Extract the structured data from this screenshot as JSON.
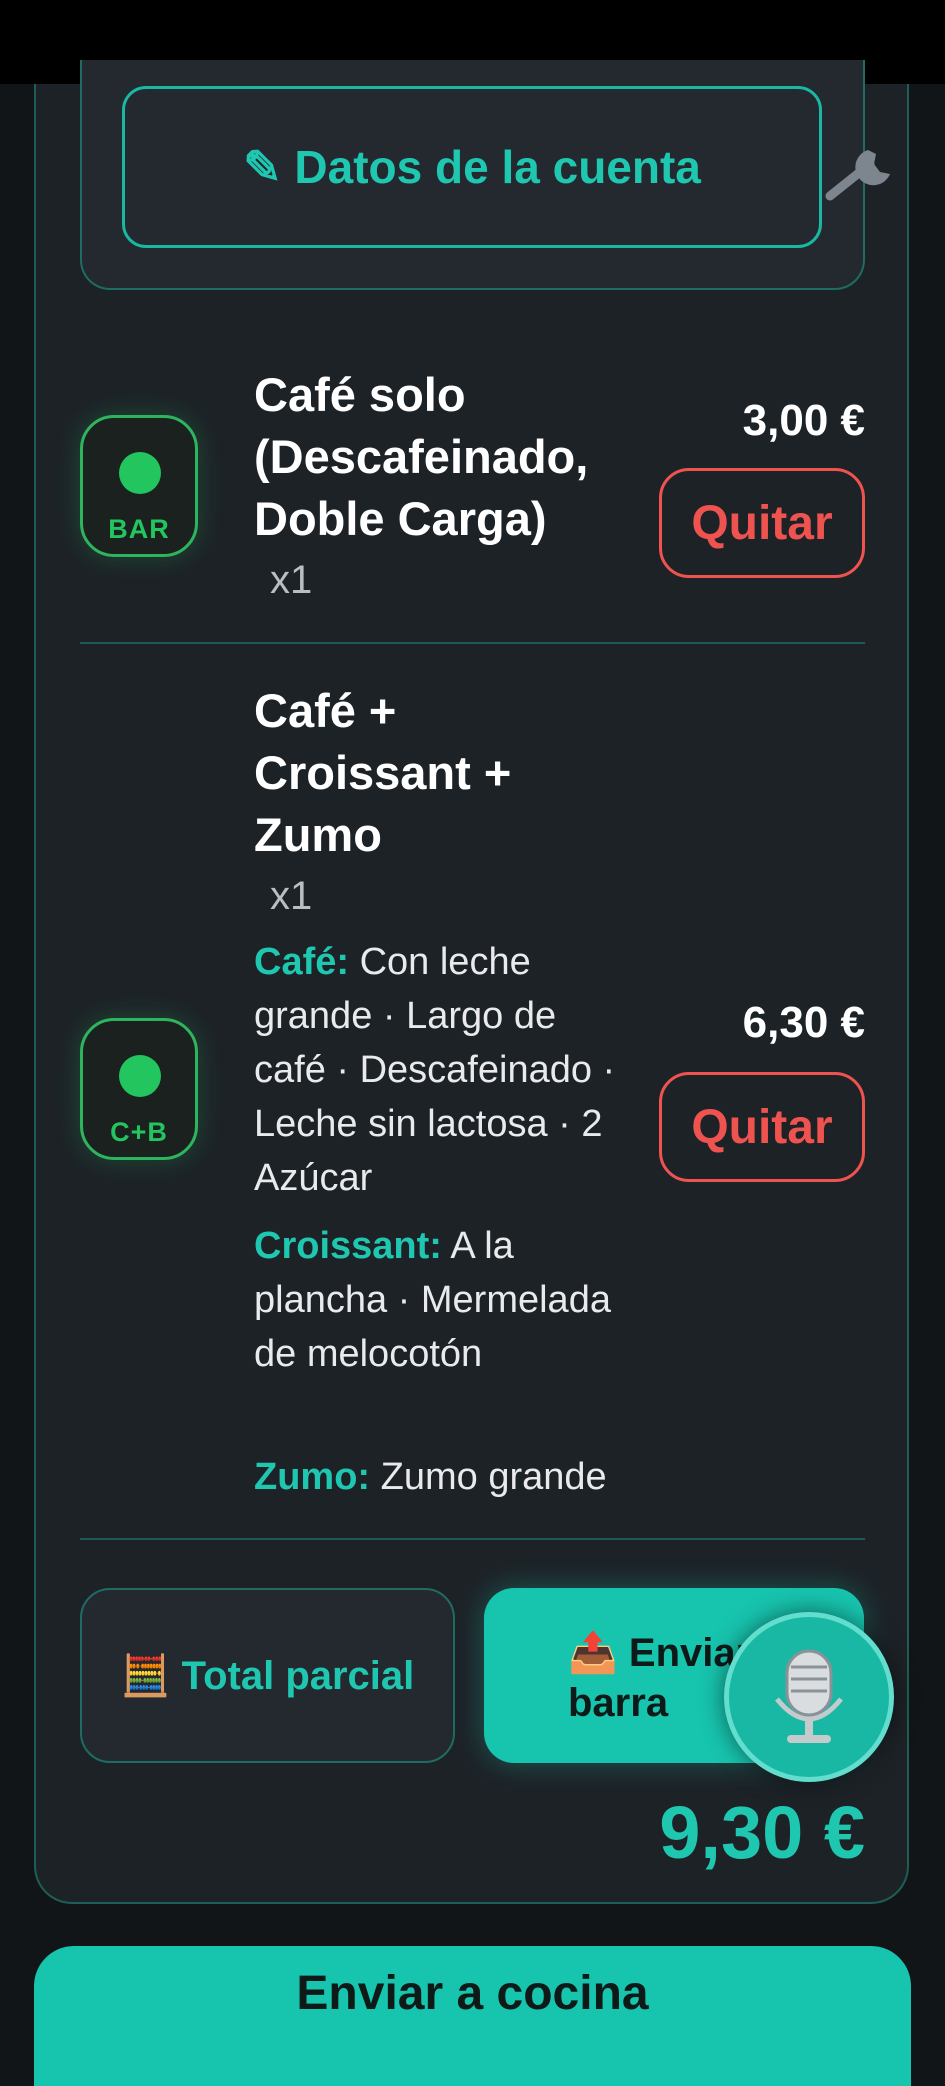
{
  "account": {
    "icon": "pencil-icon",
    "label": "✎ Datos de la cuenta"
  },
  "items": [
    {
      "badge": "BAR",
      "name": "Café solo (Descafeinado, Doble Carga)",
      "qty": "x1",
      "price": "3,00 €",
      "remove_label": "Quitar"
    },
    {
      "badge": "C+B",
      "name": "Café + Croissant + Zumo",
      "qty": "x1",
      "price": "6,30 €",
      "remove_label": "Quitar",
      "options": [
        {
          "key": "Café:",
          "value": "Con leche grande · Largo de café · Descafeinado · Leche sin lactosa · 2 Azúcar"
        },
        {
          "key": "Croissant:",
          "value": "A la plancha · Mermelada de melocotón"
        },
        {
          "key": "Zumo:",
          "value": "Zumo grande"
        }
      ]
    }
  ],
  "actions": {
    "subtotal_label": "🧮 Total parcial",
    "send_bar_label": "📤 Enviar a barra",
    "mic_icon": "microphone-icon"
  },
  "total": "9,30 €",
  "kitchen_label": "Enviar a cocina",
  "colors": {
    "accent": "#17c4ae",
    "danger": "#ef5350",
    "bar_badge": "#22c55e"
  }
}
